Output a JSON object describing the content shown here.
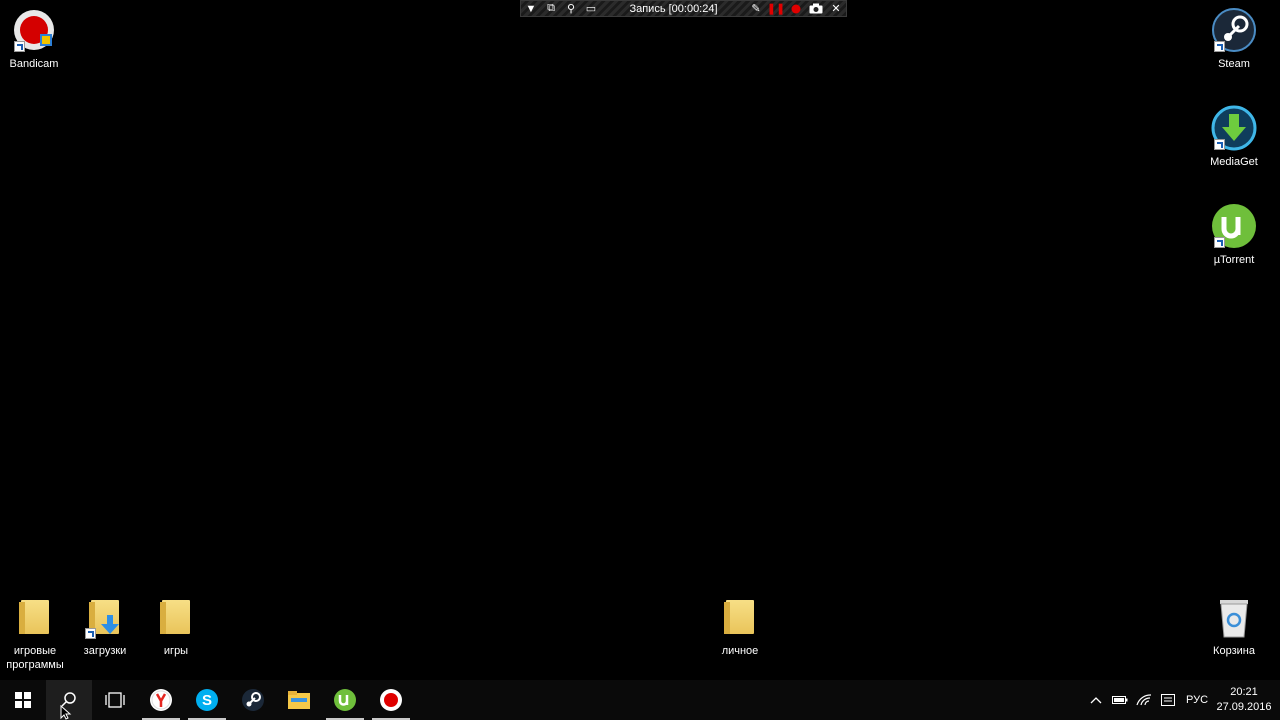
{
  "colors": {
    "desktop_bg": "#000000",
    "taskbar_bg": "#0a0a0a",
    "record_red": "#e00000"
  },
  "rec_toolbar": {
    "title": "Запись [00:00:24]"
  },
  "desktop": {
    "icons_left": [
      {
        "label": "Bandicam",
        "icon": "bandicam-icon"
      }
    ],
    "icons_right": [
      {
        "label": "Steam",
        "icon": "steam-icon"
      },
      {
        "label": "MediaGet",
        "icon": "mediaget-icon"
      },
      {
        "label": "µTorrent",
        "icon": "utorrent-icon"
      }
    ],
    "folders": [
      {
        "label": "игровые программы"
      },
      {
        "label": "загрузки"
      },
      {
        "label": "игры"
      },
      {
        "label": "личное"
      }
    ],
    "recycle_bin": {
      "label": "Корзина"
    }
  },
  "taskbar": {
    "apps": [
      "windows-start-icon",
      "search-icon",
      "task-view-icon",
      "yandex-browser-icon",
      "skype-icon",
      "steam-icon",
      "file-explorer-icon",
      "utorrent-icon",
      "bandicam-icon"
    ],
    "tray": {
      "language": "РУС",
      "time": "20:21",
      "date": "27.09.2016"
    }
  }
}
